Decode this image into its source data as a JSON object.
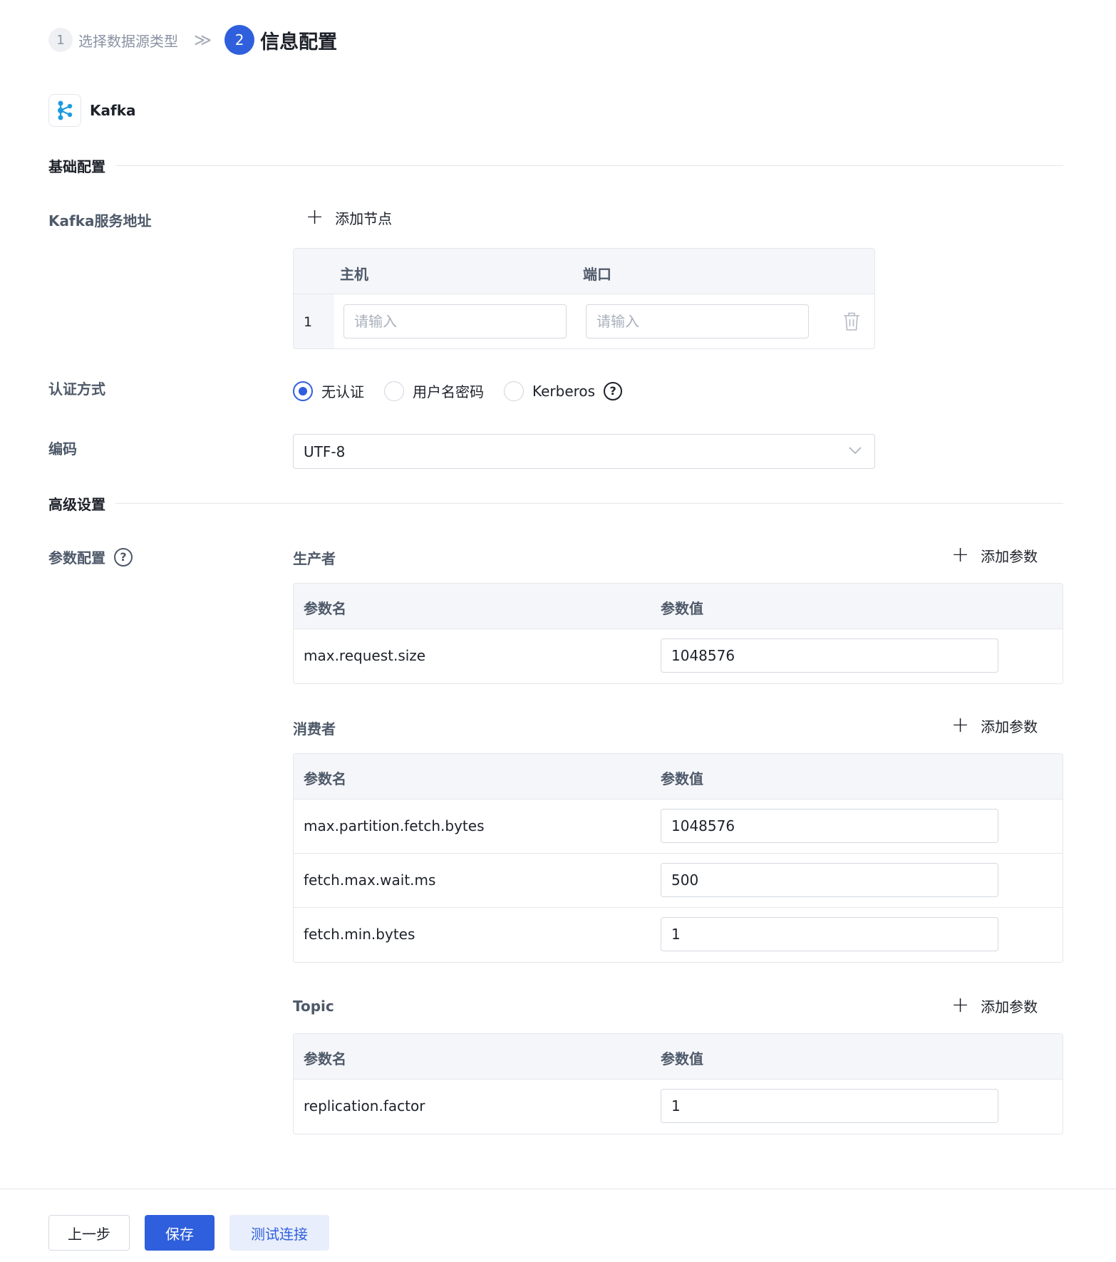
{
  "steps": {
    "step1": {
      "num": "1",
      "label": "选择数据源类型"
    },
    "separator": "≫",
    "step2": {
      "num": "2",
      "label": "信息配置"
    }
  },
  "datasource": {
    "name": "Kafka",
    "icon": "kafka-logo-icon"
  },
  "basic": {
    "title": "基础配置",
    "server_label": "Kafka服务地址",
    "add_node": "添加节点",
    "host_table": {
      "col_host": "主机",
      "col_port": "端口",
      "rows": [
        {
          "index": "1",
          "host_placeholder": "请输入",
          "port_placeholder": "请输入"
        }
      ]
    },
    "auth_label": "认证方式",
    "auth_options": [
      {
        "label": "无认证",
        "checked": true
      },
      {
        "label": "用户名密码",
        "checked": false
      },
      {
        "label": "Kerberos",
        "checked": false
      }
    ],
    "encoding_label": "编码",
    "encoding_value": "UTF-8"
  },
  "advanced": {
    "title": "高级设置",
    "param_label": "参数配置",
    "add_param": "添加参数",
    "col_name": "参数名",
    "col_value": "参数值",
    "producer": {
      "title": "生产者",
      "rows": [
        {
          "name": "max.request.size",
          "value": "1048576"
        }
      ]
    },
    "consumer": {
      "title": "消费者",
      "rows": [
        {
          "name": "max.partition.fetch.bytes",
          "value": "1048576"
        },
        {
          "name": "fetch.max.wait.ms",
          "value": "500"
        },
        {
          "name": "fetch.min.bytes",
          "value": "1"
        }
      ]
    },
    "topic": {
      "title": "Topic",
      "rows": [
        {
          "name": "replication.factor",
          "value": "1"
        }
      ]
    }
  },
  "footer": {
    "prev": "上一步",
    "save": "保存",
    "test": "测试连接"
  },
  "colors": {
    "primary": "#2f5fdc",
    "kafka_icon": "#1e9be0"
  }
}
